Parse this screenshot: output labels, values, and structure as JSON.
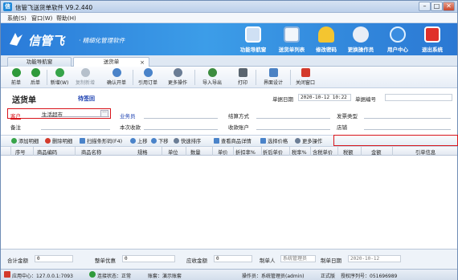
{
  "window": {
    "title": "信管飞送货单软件 V9.2.440",
    "minimize": "–",
    "maximize": "□",
    "close": "✕"
  },
  "menu": {
    "items": [
      "系统(S)",
      "窗口(W)",
      "帮助(H)"
    ]
  },
  "banner": {
    "logo_name": "信管飞",
    "slogan": "· 精细化管理软件",
    "buttons": [
      {
        "label": "功能导航窗",
        "icon": "monitor-icon",
        "color": "#cfe0f4"
      },
      {
        "label": "送货单列表",
        "icon": "list-icon",
        "color": "#f2f6fb"
      },
      {
        "label": "修改密码",
        "icon": "key-lock-icon",
        "color": "#f4c530"
      },
      {
        "label": "更换操作员",
        "icon": "user-switch-icon",
        "color": "#e9eef6"
      },
      {
        "label": "用户中心",
        "icon": "globe-icon",
        "color": "#3a8de0"
      },
      {
        "label": "退出系统",
        "icon": "power-icon",
        "color": "#e0302a"
      }
    ]
  },
  "tabs": [
    {
      "label": "功能导航窗",
      "active": false
    },
    {
      "label": "送货单",
      "active": true
    }
  ],
  "tab_close": "×",
  "toolbar": [
    {
      "label": "前单",
      "icon": "arrow-left-icon",
      "color": "#2f9a3b"
    },
    {
      "label": "后单",
      "icon": "arrow-right-icon",
      "color": "#2f9a3b"
    },
    {
      "label": "新增(W)",
      "icon": "add-icon",
      "color": "#37a44a"
    },
    {
      "label": "复制新增",
      "icon": "copy-icon",
      "color": "#b6c0cb"
    },
    {
      "label": "确认开单",
      "icon": "confirm-icon",
      "color": "#4a83c9"
    },
    {
      "label": "引用订单",
      "icon": "reference-icon",
      "color": "#4a83c9"
    },
    {
      "label": "更多操作",
      "icon": "more-icon",
      "color": "#6b7d95"
    },
    {
      "label": "导入导出",
      "icon": "import-export-icon",
      "color": "#3c8c3f"
    },
    {
      "label": "打印",
      "icon": "print-icon",
      "color": "#59646f"
    },
    {
      "label": "界面设计",
      "icon": "design-icon",
      "color": "#4b82c4"
    },
    {
      "label": "关闭窗口",
      "icon": "close-window-icon",
      "color": "#d33a2b"
    }
  ],
  "form": {
    "title": "送货单",
    "status": "待签回",
    "date_label": "单据日期",
    "date_value": "2020-10-12 10:22",
    "number_label": "单据编号",
    "number_value": "",
    "customer_label": "客户",
    "customer_value": "生活超市",
    "customer_more": "···",
    "salesperson_label": "业务员",
    "settlement_label": "结算方式",
    "invoice_label": "发票类型",
    "remark_label": "备注",
    "collected_label": "本次收款",
    "account_label": "收款账户",
    "store_label": "店铺"
  },
  "gridbar": [
    {
      "label": "添加明细",
      "color": "#37a44a"
    },
    {
      "label": "删除明细",
      "color": "#d33a2b"
    },
    {
      "label": "扫描条形码(F4)",
      "color": "#4a83c9"
    },
    {
      "label": "上移",
      "color": "#4a83c9"
    },
    {
      "label": "下移",
      "color": "#4a83c9"
    },
    {
      "label": "快速排序",
      "color": "#6b7d95"
    },
    {
      "label": "查看商品详情",
      "color": "#4a83c9"
    },
    {
      "label": "选择价格",
      "color": "#4a83c9"
    },
    {
      "label": "更多操作",
      "color": "#6b7d95"
    }
  ],
  "grid": {
    "columns": [
      "序号",
      "商品编码",
      "商品名称",
      "规格",
      "单位",
      "数量",
      "单价",
      "折扣率%",
      "折后单价",
      "税率%",
      "含税单价",
      "税额",
      "金额",
      "引单信息"
    ]
  },
  "totals": {
    "total_label": "合计金额",
    "total_value": "0",
    "discount_label": "整单优惠",
    "discount_value": "0",
    "receivable_label": "应收金额",
    "receivable_value": "0",
    "maker_label": "制单人",
    "maker_value": "系统管理员",
    "make_date_label": "制单日期",
    "make_date_value": "2020-10-12"
  },
  "status": {
    "app_center": "应用中心：127.0.0.1:7093",
    "connection": "连接状态：正常",
    "set": "账套：演示账套",
    "operator": "操作员：系统管理员(admin)",
    "edition": "正式版",
    "auth": "授权序列号：051696989"
  }
}
